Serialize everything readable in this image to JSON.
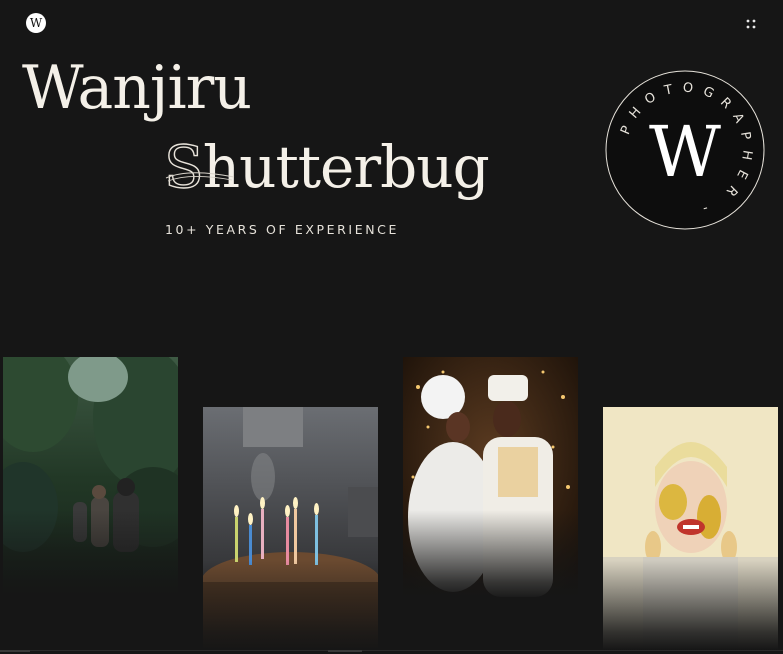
{
  "header": {
    "logo_letter": "W",
    "menu_icon": "grid-dots-icon"
  },
  "hero": {
    "title_line1": "Wanjiru",
    "title_line2_first": "S",
    "title_line2_rest": "hutterbug",
    "tagline": "10+ YEARS OF EXPERIENCE"
  },
  "badge": {
    "monogram": "W",
    "ring_text": "PHOTOGRAPHER -"
  },
  "gallery": [
    {
      "subject": "hikers-forest-trail"
    },
    {
      "subject": "birthday-cake-candles"
    },
    {
      "subject": "wedding-couple"
    },
    {
      "subject": "woman-gold-face-paint"
    }
  ],
  "colors": {
    "background": "#161616",
    "text": "#f2eee6",
    "badge_ring": "#e6e2da"
  }
}
